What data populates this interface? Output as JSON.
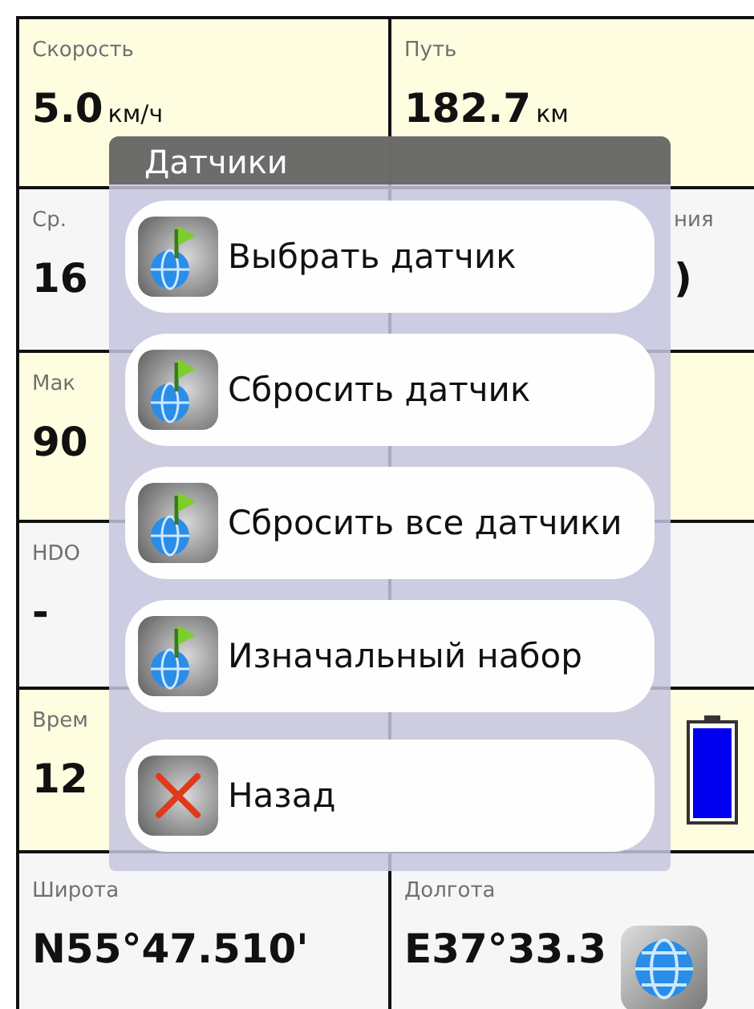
{
  "cells": [
    {
      "label": "Скорость",
      "value": "5.0",
      "unit": "км/ч"
    },
    {
      "label": "Путь",
      "value": "182.7",
      "unit": "км"
    },
    {
      "label": "Ср.",
      "value": "16"
    },
    {
      "label": "ния",
      "value": ")",
      "kind": "peek"
    },
    {
      "label": "Мак",
      "value": "90"
    },
    {
      "kind": "blank"
    },
    {
      "label": "HDO",
      "value": "-"
    },
    {
      "kind": "battery"
    },
    {
      "label": "Врем",
      "value": "12"
    },
    {
      "kind": "battery-icon"
    },
    {
      "label": "Широта",
      "value": "N55°47.510'"
    },
    {
      "label": "Долгота",
      "value": "E37°33.3",
      "kind": "globe"
    }
  ],
  "popup": {
    "title": "Датчики",
    "items": [
      {
        "label": "Выбрать датчик",
        "kind": "sensor"
      },
      {
        "label": "Сбросить датчик",
        "kind": "sensor"
      },
      {
        "label": "Сбросить все датчики",
        "kind": "sensor"
      },
      {
        "label": "Изначальный набор",
        "kind": "sensor"
      },
      {
        "label": "Назад",
        "kind": "back"
      }
    ]
  }
}
